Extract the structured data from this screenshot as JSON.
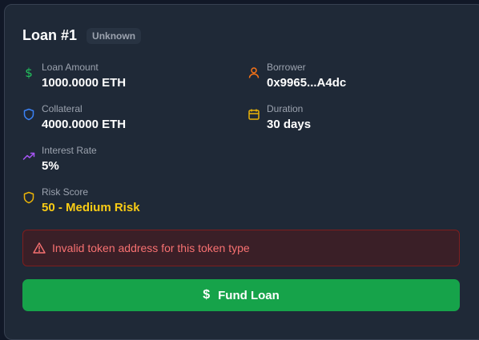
{
  "loan": {
    "title": "Loan #1",
    "status": "Unknown"
  },
  "fields": {
    "loan_amount": {
      "label": "Loan Amount",
      "value": "1000.0000 ETH",
      "icon": "dollar-icon",
      "color": "#22c55e"
    },
    "borrower": {
      "label": "Borrower",
      "value": "0x9965...A4dc",
      "icon": "user-icon",
      "color": "#f97316"
    },
    "collateral": {
      "label": "Collateral",
      "value": "4000.0000 ETH",
      "icon": "shield-icon",
      "color": "#3b82f6"
    },
    "duration": {
      "label": "Duration",
      "value": "30 days",
      "icon": "calendar-icon",
      "color": "#eab308"
    },
    "interest_rate": {
      "label": "Interest Rate",
      "value": "5%",
      "icon": "trending-up-icon",
      "color": "#a855f7"
    },
    "risk_score": {
      "label": "Risk Score",
      "value": "50 - Medium Risk",
      "icon": "shield-icon",
      "color": "#eab308"
    }
  },
  "alert": {
    "message": "Invalid token address for this token type",
    "icon": "warning-triangle-icon",
    "color": "#f87171"
  },
  "actions": {
    "fund_label": "Fund Loan",
    "fund_icon": "dollar-icon",
    "fund_color": "#16a34a"
  }
}
